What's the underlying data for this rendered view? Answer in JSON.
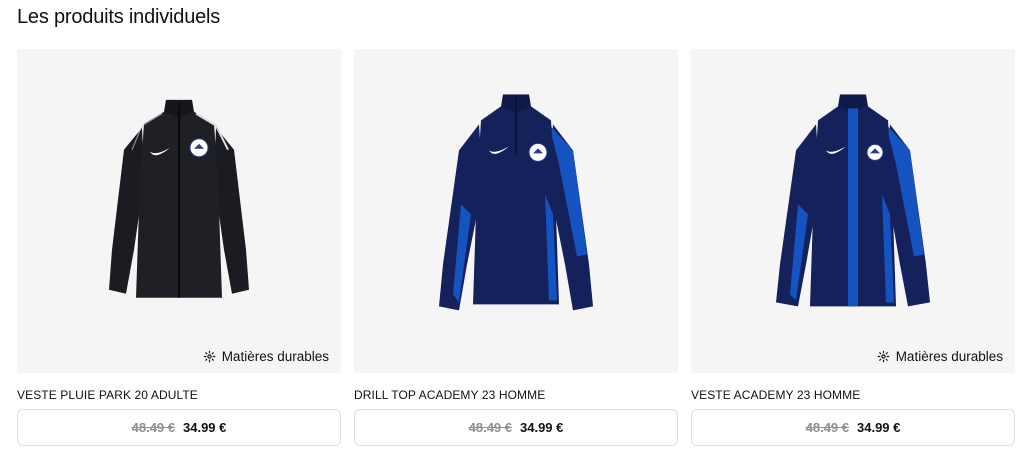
{
  "section": {
    "title": "Les produits individuels"
  },
  "badge_icon": "sustainable-materials-icon",
  "products": [
    {
      "name": "VESTE PLUIE PARK 20 ADULTE",
      "badge": "Matières durables",
      "old_price": "48.49 €",
      "price": "34.99 €",
      "colors": {
        "body": "#1b1c22",
        "accent": "#dcdcdc"
      }
    },
    {
      "name": "DRILL TOP ACADEMY 23 HOMME",
      "badge": "",
      "old_price": "48.49 €",
      "price": "34.99 €",
      "colors": {
        "body": "#14215a",
        "accent": "#1553c0"
      }
    },
    {
      "name": "VESTE ACADEMY 23 HOMME",
      "badge": "Matières durables",
      "old_price": "48.49 €",
      "price": "34.99 €",
      "colors": {
        "body": "#14215a",
        "accent": "#1553c0"
      }
    }
  ]
}
